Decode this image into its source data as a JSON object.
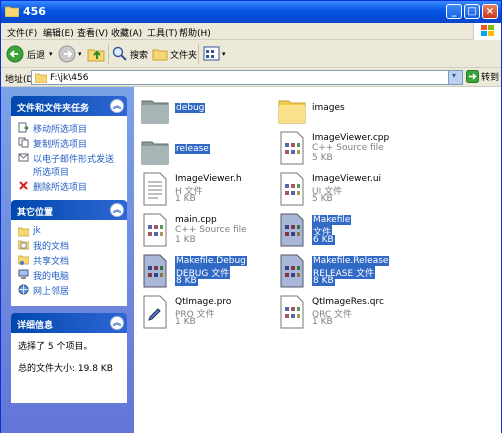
{
  "window": {
    "title": "456",
    "buttons": {
      "minimize": "_",
      "maximize": "□",
      "close": "×"
    }
  },
  "menu": [
    {
      "id": "file",
      "label": "文件(F)"
    },
    {
      "id": "edit",
      "label": "编辑(E)"
    },
    {
      "id": "view",
      "label": "查看(V)"
    },
    {
      "id": "favorites",
      "label": "收藏(A)"
    },
    {
      "id": "tools",
      "label": "工具(T)"
    },
    {
      "id": "help",
      "label": "帮助(H)"
    }
  ],
  "toolbar": {
    "back_label": "后退",
    "search_label": "搜索",
    "folders_label": "文件夹"
  },
  "address": {
    "label": "地址(D)",
    "value": "F:\\jk\\456",
    "go_label": "转到"
  },
  "taskpane": {
    "tasks": {
      "title": "文件和文件夹任务",
      "items": [
        {
          "label": "移动所选项目",
          "icon": "move-icon"
        },
        {
          "label": "复制所选项目",
          "icon": "copy-icon"
        },
        {
          "label": "以电子邮件形式发送所选项目",
          "icon": "email-icon"
        },
        {
          "label": "删除所选项目",
          "icon": "delete-icon"
        }
      ]
    },
    "places": {
      "title": "其它位置",
      "items": [
        {
          "label": "jk",
          "icon": "folder-icon"
        },
        {
          "label": "我的文档",
          "icon": "my-documents-icon"
        },
        {
          "label": "共享文档",
          "icon": "shared-documents-icon"
        },
        {
          "label": "我的电脑",
          "icon": "my-computer-icon"
        },
        {
          "label": "网上邻居",
          "icon": "network-icon"
        }
      ]
    },
    "details": {
      "title": "详细信息",
      "selected": "选择了 5 个项目。",
      "total": "总的文件大小: 19.8 KB"
    }
  },
  "files": [
    {
      "name": "debug",
      "type": "",
      "size": "",
      "kind": "folder",
      "selected": true
    },
    {
      "name": "images",
      "type": "",
      "size": "",
      "kind": "folder",
      "selected": false
    },
    {
      "name": "release",
      "type": "",
      "size": "",
      "kind": "folder",
      "selected": true
    },
    {
      "name": "ImageViewer.cpp",
      "type": "C++ Source file",
      "size": "5 KB",
      "kind": "doc",
      "selected": false
    },
    {
      "name": "ImageViewer.h",
      "type": "H 文件",
      "size": "1 KB",
      "kind": "text",
      "selected": false
    },
    {
      "name": "ImageViewer.ui",
      "type": "UI 文件",
      "size": "5 KB",
      "kind": "doc",
      "selected": false
    },
    {
      "name": "main.cpp",
      "type": "C++ Source file",
      "size": "1 KB",
      "kind": "doc",
      "selected": false
    },
    {
      "name": "Makefile",
      "type": "文件",
      "size": "6 KB",
      "kind": "doc",
      "selected": true
    },
    {
      "name": "Makefile.Debug",
      "type": "DEBUG 文件",
      "size": "8 KB",
      "kind": "doc",
      "selected": true
    },
    {
      "name": "Makefile.Release",
      "type": "RELEASE 文件",
      "size": "8 KB",
      "kind": "doc",
      "selected": true
    },
    {
      "name": "QtImage.pro",
      "type": "PRO 文件",
      "size": "1 KB",
      "kind": "pro",
      "selected": false
    },
    {
      "name": "QtImageRes.qrc",
      "type": "QRC 文件",
      "size": "1 KB",
      "kind": "doc",
      "selected": false
    }
  ],
  "colors": {
    "selection": "#316ac5",
    "link": "#215dc6",
    "titlebar": "#0a58e4"
  }
}
